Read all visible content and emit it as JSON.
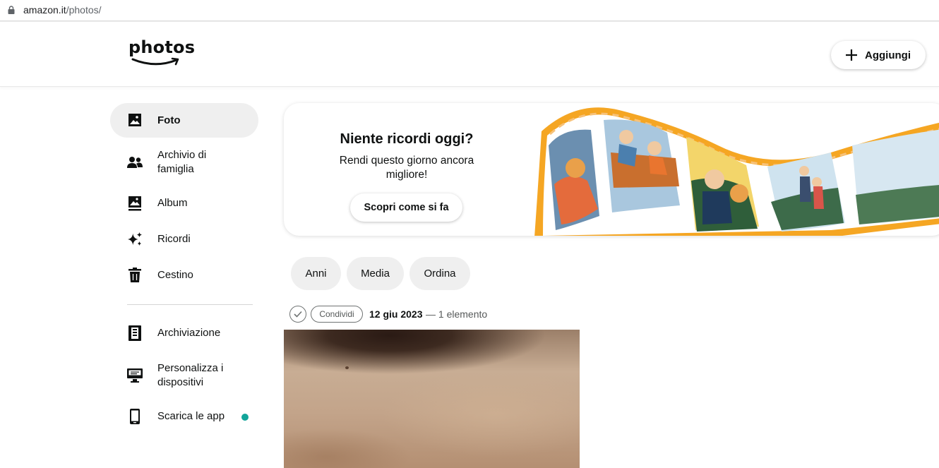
{
  "browser": {
    "url_domain": "amazon.it",
    "url_path": "/photos/"
  },
  "header": {
    "logo_text": "photos",
    "add_label": "Aggiungi"
  },
  "sidebar": {
    "items": [
      {
        "label": "Foto",
        "icon": "image-icon",
        "active": true
      },
      {
        "label": "Archivio di famiglia",
        "icon": "people-icon",
        "active": false
      },
      {
        "label": "Album",
        "icon": "album-icon",
        "active": false
      },
      {
        "label": "Ricordi",
        "icon": "sparkle-icon",
        "active": false
      },
      {
        "label": "Cestino",
        "icon": "trash-icon",
        "active": false
      },
      {
        "label": "Archiviazione",
        "icon": "storage-icon",
        "active": false
      },
      {
        "label": "Personalizza i dispositivi",
        "icon": "monitor-icon",
        "active": false
      },
      {
        "label": "Scarica le app",
        "icon": "phone-icon",
        "active": false,
        "notification_dot": true
      }
    ]
  },
  "banner": {
    "title": "Niente ricordi oggi?",
    "subtitle": "Rendi questo giorno ancora migliore!",
    "cta_label": "Scopri come si fa"
  },
  "filters": {
    "chips": [
      "Anni",
      "Media",
      "Ordina"
    ]
  },
  "group": {
    "share_label": "Condividi",
    "date": "12 giu 2023",
    "count": "— 1 elemento"
  },
  "colors": {
    "active_bg": "#efefef",
    "dot": "#12a59a",
    "film_orange": "#f5a623"
  }
}
